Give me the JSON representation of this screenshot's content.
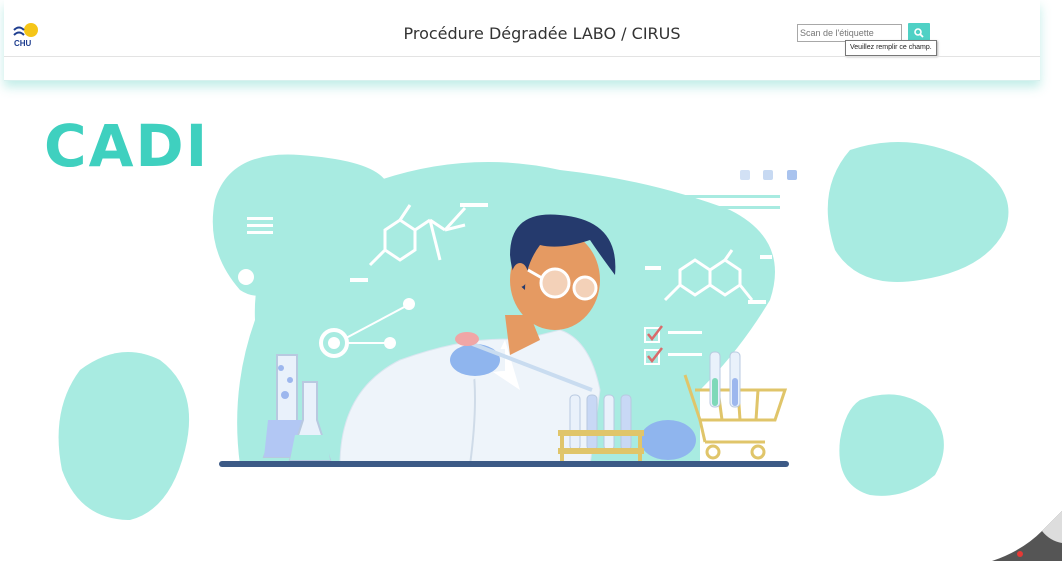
{
  "header": {
    "title": "Procédure Dégradée LABO / CIRUS",
    "logo_text": "CHU",
    "search": {
      "placeholder": "Scan de l'étiquette",
      "button_icon": "search-icon"
    },
    "tooltip": "Veuillez remplir ce champ."
  },
  "hero": {
    "brand": "CADI",
    "illustration": "scientist-lab-illustration"
  },
  "colors": {
    "accent": "#4fd1c5",
    "blob": "#a8ebe1",
    "brand": "#3fd0bf",
    "navy": "#1f3e8f"
  }
}
